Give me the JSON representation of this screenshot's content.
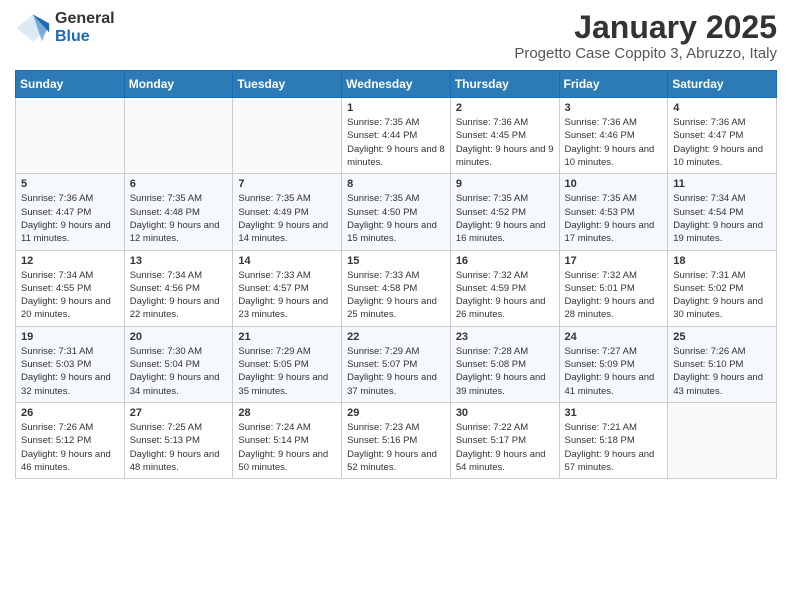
{
  "logo": {
    "general": "General",
    "blue": "Blue"
  },
  "title": "January 2025",
  "subtitle": "Progetto Case Coppito 3, Abruzzo, Italy",
  "weekdays": [
    "Sunday",
    "Monday",
    "Tuesday",
    "Wednesday",
    "Thursday",
    "Friday",
    "Saturday"
  ],
  "weeks": [
    [
      {
        "day": "",
        "info": ""
      },
      {
        "day": "",
        "info": ""
      },
      {
        "day": "",
        "info": ""
      },
      {
        "day": "1",
        "info": "Sunrise: 7:35 AM\nSunset: 4:44 PM\nDaylight: 9 hours\nand 8 minutes."
      },
      {
        "day": "2",
        "info": "Sunrise: 7:36 AM\nSunset: 4:45 PM\nDaylight: 9 hours\nand 9 minutes."
      },
      {
        "day": "3",
        "info": "Sunrise: 7:36 AM\nSunset: 4:46 PM\nDaylight: 9 hours\nand 10 minutes."
      },
      {
        "day": "4",
        "info": "Sunrise: 7:36 AM\nSunset: 4:47 PM\nDaylight: 9 hours\nand 10 minutes."
      }
    ],
    [
      {
        "day": "5",
        "info": "Sunrise: 7:36 AM\nSunset: 4:47 PM\nDaylight: 9 hours\nand 11 minutes."
      },
      {
        "day": "6",
        "info": "Sunrise: 7:35 AM\nSunset: 4:48 PM\nDaylight: 9 hours\nand 12 minutes."
      },
      {
        "day": "7",
        "info": "Sunrise: 7:35 AM\nSunset: 4:49 PM\nDaylight: 9 hours\nand 14 minutes."
      },
      {
        "day": "8",
        "info": "Sunrise: 7:35 AM\nSunset: 4:50 PM\nDaylight: 9 hours\nand 15 minutes."
      },
      {
        "day": "9",
        "info": "Sunrise: 7:35 AM\nSunset: 4:52 PM\nDaylight: 9 hours\nand 16 minutes."
      },
      {
        "day": "10",
        "info": "Sunrise: 7:35 AM\nSunset: 4:53 PM\nDaylight: 9 hours\nand 17 minutes."
      },
      {
        "day": "11",
        "info": "Sunrise: 7:34 AM\nSunset: 4:54 PM\nDaylight: 9 hours\nand 19 minutes."
      }
    ],
    [
      {
        "day": "12",
        "info": "Sunrise: 7:34 AM\nSunset: 4:55 PM\nDaylight: 9 hours\nand 20 minutes."
      },
      {
        "day": "13",
        "info": "Sunrise: 7:34 AM\nSunset: 4:56 PM\nDaylight: 9 hours\nand 22 minutes."
      },
      {
        "day": "14",
        "info": "Sunrise: 7:33 AM\nSunset: 4:57 PM\nDaylight: 9 hours\nand 23 minutes."
      },
      {
        "day": "15",
        "info": "Sunrise: 7:33 AM\nSunset: 4:58 PM\nDaylight: 9 hours\nand 25 minutes."
      },
      {
        "day": "16",
        "info": "Sunrise: 7:32 AM\nSunset: 4:59 PM\nDaylight: 9 hours\nand 26 minutes."
      },
      {
        "day": "17",
        "info": "Sunrise: 7:32 AM\nSunset: 5:01 PM\nDaylight: 9 hours\nand 28 minutes."
      },
      {
        "day": "18",
        "info": "Sunrise: 7:31 AM\nSunset: 5:02 PM\nDaylight: 9 hours\nand 30 minutes."
      }
    ],
    [
      {
        "day": "19",
        "info": "Sunrise: 7:31 AM\nSunset: 5:03 PM\nDaylight: 9 hours\nand 32 minutes."
      },
      {
        "day": "20",
        "info": "Sunrise: 7:30 AM\nSunset: 5:04 PM\nDaylight: 9 hours\nand 34 minutes."
      },
      {
        "day": "21",
        "info": "Sunrise: 7:29 AM\nSunset: 5:05 PM\nDaylight: 9 hours\nand 35 minutes."
      },
      {
        "day": "22",
        "info": "Sunrise: 7:29 AM\nSunset: 5:07 PM\nDaylight: 9 hours\nand 37 minutes."
      },
      {
        "day": "23",
        "info": "Sunrise: 7:28 AM\nSunset: 5:08 PM\nDaylight: 9 hours\nand 39 minutes."
      },
      {
        "day": "24",
        "info": "Sunrise: 7:27 AM\nSunset: 5:09 PM\nDaylight: 9 hours\nand 41 minutes."
      },
      {
        "day": "25",
        "info": "Sunrise: 7:26 AM\nSunset: 5:10 PM\nDaylight: 9 hours\nand 43 minutes."
      }
    ],
    [
      {
        "day": "26",
        "info": "Sunrise: 7:26 AM\nSunset: 5:12 PM\nDaylight: 9 hours\nand 46 minutes."
      },
      {
        "day": "27",
        "info": "Sunrise: 7:25 AM\nSunset: 5:13 PM\nDaylight: 9 hours\nand 48 minutes."
      },
      {
        "day": "28",
        "info": "Sunrise: 7:24 AM\nSunset: 5:14 PM\nDaylight: 9 hours\nand 50 minutes."
      },
      {
        "day": "29",
        "info": "Sunrise: 7:23 AM\nSunset: 5:16 PM\nDaylight: 9 hours\nand 52 minutes."
      },
      {
        "day": "30",
        "info": "Sunrise: 7:22 AM\nSunset: 5:17 PM\nDaylight: 9 hours\nand 54 minutes."
      },
      {
        "day": "31",
        "info": "Sunrise: 7:21 AM\nSunset: 5:18 PM\nDaylight: 9 hours\nand 57 minutes."
      },
      {
        "day": "",
        "info": ""
      }
    ]
  ]
}
